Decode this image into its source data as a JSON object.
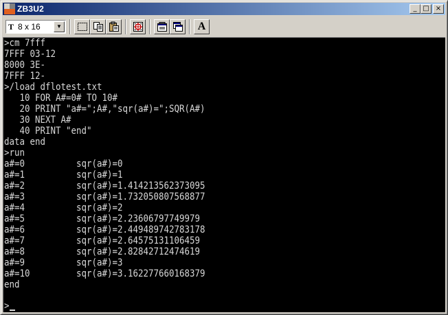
{
  "window": {
    "title": "ZB3U2",
    "minimize": "_",
    "maximize": "□",
    "close": "×"
  },
  "toolbar": {
    "font_glyph": "T",
    "font_size_value": "8 x 16",
    "font_select_arrow": "▼",
    "bold_a_label": "A",
    "icons": [
      "select-rect-icon",
      "copy-icon",
      "paste-icon",
      "target-icon",
      "properties-icon",
      "window-icon",
      "font-a-icon"
    ]
  },
  "console": {
    "lines": [
      ">cm 7fff",
      "7FFF 03-12",
      "8000 3E-",
      "7FFF 12-",
      ">/load dflotest.txt",
      "   10 FOR A#=0# TO 10#",
      "   20 PRINT \"a#=\";A#,\"sqr(a#)=\";SQR(A#)",
      "   30 NEXT A#",
      "   40 PRINT \"end\"",
      "data end",
      ">run",
      "a#=0          sqr(a#)=0",
      "a#=1          sqr(a#)=1",
      "a#=2          sqr(a#)=1.414213562373095",
      "a#=3          sqr(a#)=1.732050807568877",
      "a#=4          sqr(a#)=2",
      "a#=5          sqr(a#)=2.23606797749979",
      "a#=6          sqr(a#)=2.449489742783178",
      "a#=7          sqr(a#)=2.64575131106459",
      "a#=8          sqr(a#)=2.82842712474619",
      "a#=9          sqr(a#)=3",
      "a#=10         sqr(a#)=3.162277660168379",
      "end"
    ],
    "prompt": ">"
  },
  "colors": {
    "terminal_bg": "#000000",
    "terminal_fg": "#d8d8d8",
    "titlebar_start": "#0a246a",
    "titlebar_end": "#a6caf0"
  }
}
